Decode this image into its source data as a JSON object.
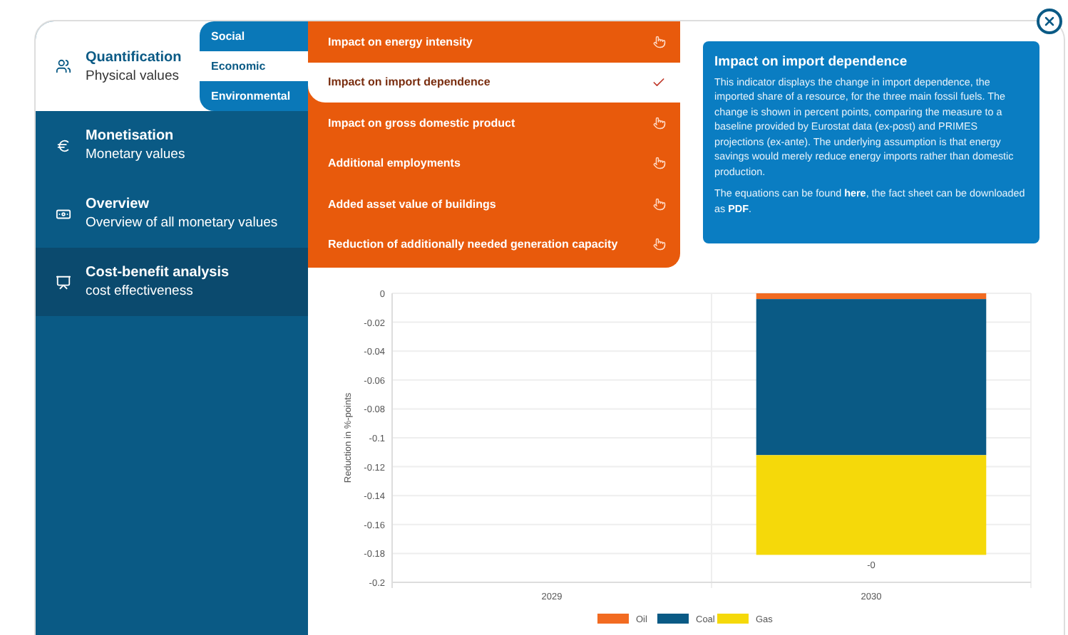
{
  "sidebar": {
    "items": [
      {
        "title": "Quantification",
        "subtitle": "Physical values",
        "selected": true,
        "hovered": false
      },
      {
        "title": "Monetisation",
        "subtitle": "Monetary values",
        "selected": false,
        "hovered": false
      },
      {
        "title": "Overview",
        "subtitle": "Overview of all monetary values",
        "selected": false,
        "hovered": false
      },
      {
        "title": "Cost-benefit analysis",
        "subtitle": "cost effectiveness",
        "selected": false,
        "hovered": true
      }
    ]
  },
  "subtabs": [
    {
      "label": "Social",
      "selected": false
    },
    {
      "label": "Economic",
      "selected": true
    },
    {
      "label": "Environmental",
      "selected": false
    }
  ],
  "indicators": [
    {
      "label": "Impact on energy intensity",
      "selected": false
    },
    {
      "label": "Impact on import dependence",
      "selected": true
    },
    {
      "label": "Impact on gross domestic product",
      "selected": false
    },
    {
      "label": "Additional employments",
      "selected": false
    },
    {
      "label": "Added asset value of buildings",
      "selected": false
    },
    {
      "label": "Reduction of additionally needed generation capacity",
      "selected": false
    }
  ],
  "info": {
    "title": "Impact on import dependence",
    "paragraphs": [
      "This indicator displays the change in import dependence, the imported share of a resource, for the three main fossil fuels. The change is shown in percent points, comparing the measure to a baseline provided by Eurostat data (ex-post) and PRIMES projections (ex-ante). The underlying assumption is that energy savings would merely reduce energy imports rather than domestic production.",
      "The equations can be found **here**, the fact sheet can be downloaded as **PDF**."
    ]
  },
  "chart_data": {
    "type": "bar",
    "ylabel": "Reduction in %-points",
    "categories": [
      "2029",
      "2030"
    ],
    "stacked": true,
    "ylim": [
      -0.2,
      0
    ],
    "yticks": [
      0,
      -0.02,
      -0.04,
      -0.06,
      -0.08,
      -0.1,
      -0.12,
      -0.14,
      -0.16,
      -0.18,
      -0.2
    ],
    "series": [
      {
        "name": "Oil",
        "color": "#f26b21",
        "values": [
          null,
          -0.004
        ]
      },
      {
        "name": "Coal",
        "color": "#0a5a85",
        "values": [
          null,
          -0.108
        ]
      },
      {
        "name": "Gas",
        "color": "#f5d90a",
        "values": [
          null,
          -0.069
        ]
      }
    ],
    "grid": true,
    "legend": true,
    "annotations": [
      "-0"
    ]
  }
}
